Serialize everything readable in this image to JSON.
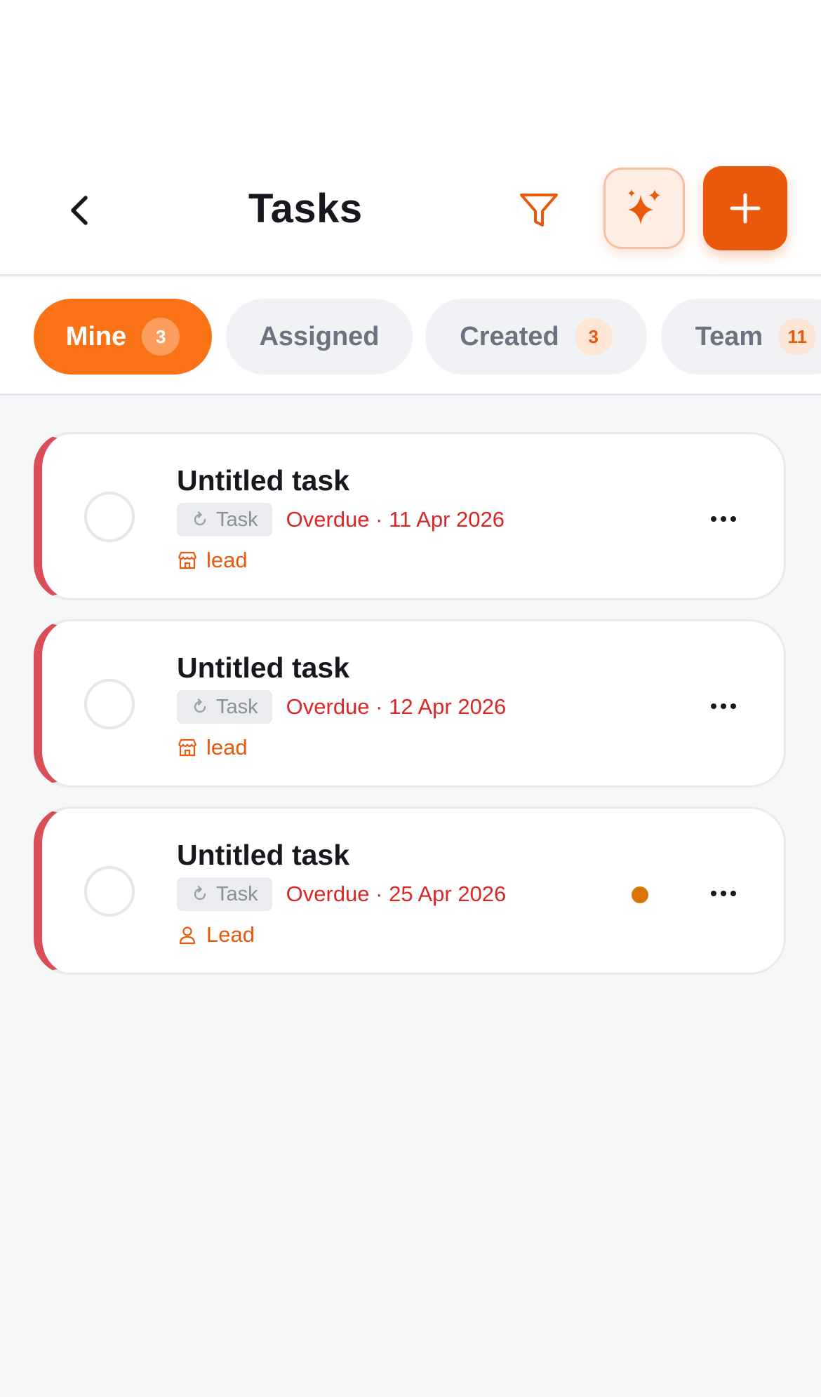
{
  "header": {
    "title": "Tasks",
    "icons": {
      "back": "chevron-left-icon",
      "filter": "funnel-icon",
      "ai": "sparkles-icon",
      "add": "plus-icon"
    }
  },
  "colors": {
    "accent": "#F97316",
    "accent_dark": "#EA580C",
    "overdue": "#DC2626",
    "overdue_bar": "#D94E57",
    "status_dot": "#D97706"
  },
  "tabs": [
    {
      "label": "Mine",
      "count": "3",
      "active": true
    },
    {
      "label": "Assigned",
      "count": "",
      "active": false
    },
    {
      "label": "Created",
      "count": "3",
      "active": false
    },
    {
      "label": "Team",
      "count": "11",
      "active": false
    }
  ],
  "tasks": [
    {
      "title": "Untitled task",
      "type": "Task",
      "due": "Overdue · 11 Apr 2026",
      "link_label": "lead",
      "link_icon": "storefront-icon",
      "has_dot": false
    },
    {
      "title": "Untitled task",
      "type": "Task",
      "due": "Overdue · 12 Apr 2026",
      "link_label": "lead",
      "link_icon": "storefront-icon",
      "has_dot": false
    },
    {
      "title": "Untitled task",
      "type": "Task",
      "due": "Overdue · 25 Apr 2026",
      "link_label": "Lead",
      "link_icon": "person-icon",
      "has_dot": true
    }
  ]
}
